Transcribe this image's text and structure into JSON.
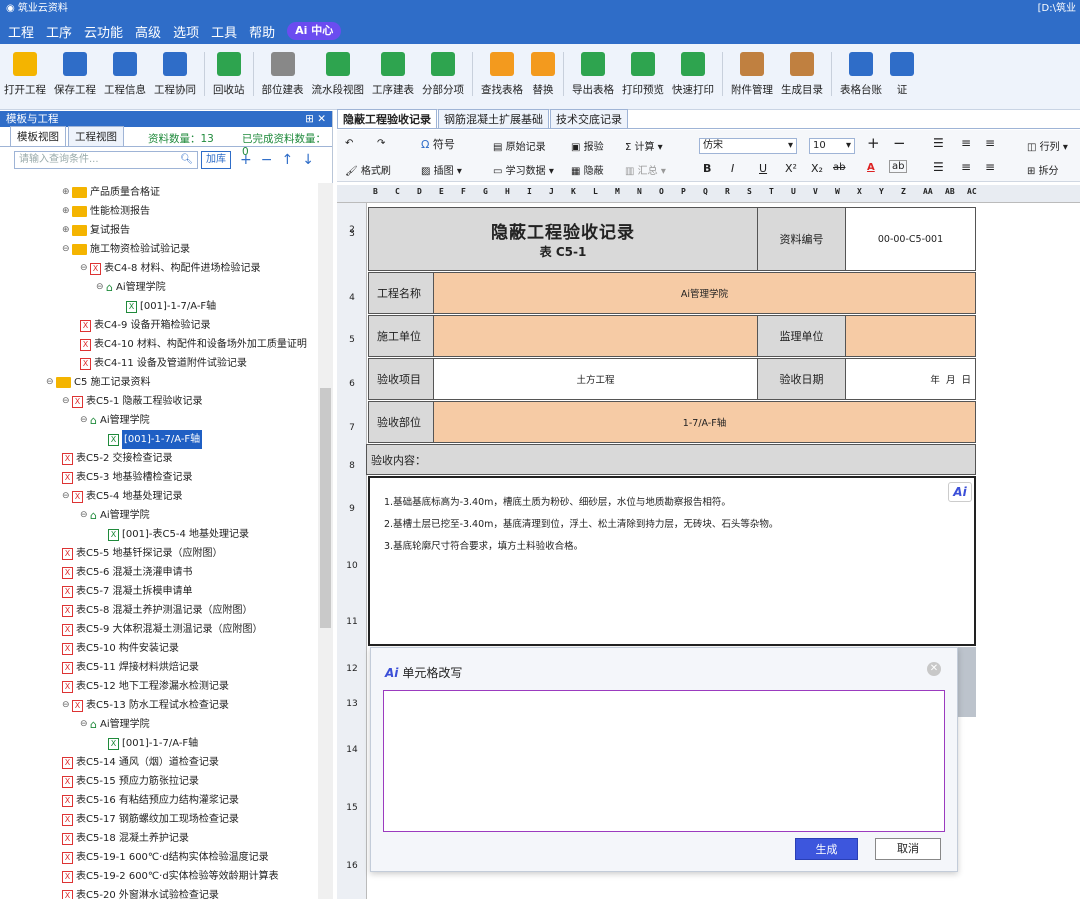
{
  "app": {
    "title": "筑业云资料",
    "path": "[D:\\筑业"
  },
  "menu": [
    "工程",
    "工序",
    "云功能",
    "高级",
    "选项",
    "工具",
    "帮助"
  ],
  "menu_ai": "Ai 中心",
  "toolbar": [
    {
      "label": "打开工程",
      "icon": "open-folder-icon",
      "color": "#f4b400"
    },
    {
      "label": "保存工程",
      "icon": "save-icon",
      "color": "#2f6dc8"
    },
    {
      "label": "工程信息",
      "icon": "project-info-icon",
      "color": "#2f6dc8"
    },
    {
      "label": "工程协同",
      "icon": "handshake-icon",
      "color": "#2f6dc8"
    },
    {
      "label": "回收站",
      "icon": "trash-icon",
      "color": "#2ea44f"
    },
    {
      "label": "部位建表",
      "icon": "table-part-icon",
      "color": "#888888"
    },
    {
      "label": "流水段视图",
      "icon": "flow-view-icon",
      "color": "#2ea44f"
    },
    {
      "label": "工序建表",
      "icon": "process-table-icon",
      "color": "#2ea44f"
    },
    {
      "label": "分部分项",
      "icon": "bar-chart-icon",
      "color": "#2ea44f"
    },
    {
      "label": "查找表格",
      "icon": "find-table-icon",
      "color": "#f39a1e"
    },
    {
      "label": "替换",
      "icon": "replace-icon",
      "color": "#f39a1e"
    },
    {
      "label": "导出表格",
      "icon": "export-icon",
      "color": "#2ea44f"
    },
    {
      "label": "打印预览",
      "icon": "print-preview-icon",
      "color": "#2ea44f"
    },
    {
      "label": "快速打印",
      "icon": "printer-icon",
      "color": "#2ea44f"
    },
    {
      "label": "附件管理",
      "icon": "attachment-icon",
      "color": "#c08040"
    },
    {
      "label": "生成目录",
      "icon": "catalog-icon",
      "color": "#c08040"
    },
    {
      "label": "表格台账",
      "icon": "ledger-icon",
      "color": "#2f6dc8"
    },
    {
      "label": "证",
      "icon": "cert-icon",
      "color": "#2f6dc8"
    }
  ],
  "left_panel": {
    "title": "模板与工程",
    "tab_template": "模板视图",
    "tab_project": "工程视图",
    "count_label": "资料数量：13",
    "done_label": "已完成资料数量：0",
    "search_placeholder": "请输入查询条件...",
    "search_add_btn": "加库"
  },
  "tree": [
    {
      "text": "产品质量合格证",
      "icon": "folder",
      "indent": 62,
      "toggle": "⊕"
    },
    {
      "text": "性能检测报告",
      "icon": "folder",
      "indent": 62,
      "toggle": "⊕"
    },
    {
      "text": "复试报告",
      "icon": "folder",
      "indent": 62,
      "toggle": "⊕"
    },
    {
      "text": "施工物资检验试验记录",
      "icon": "folder",
      "indent": 62,
      "toggle": "⊖"
    },
    {
      "text": "表C4-8 材料、构配件进场检验记录",
      "icon": "xr",
      "indent": 80,
      "toggle": "⊖"
    },
    {
      "text": "Ai管理学院",
      "icon": "home",
      "indent": 96,
      "toggle": "⊖"
    },
    {
      "text": "[001]-1-7/A-F轴",
      "icon": "xg",
      "indent": 126,
      "toggle": ""
    },
    {
      "text": "表C4-9 设备开箱检验记录",
      "icon": "xr",
      "indent": 80,
      "toggle": ""
    },
    {
      "text": "表C4-10 材料、构配件和设备场外加工质量证明",
      "icon": "xr",
      "indent": 80,
      "toggle": ""
    },
    {
      "text": "表C4-11 设备及管道附件试验记录",
      "icon": "xr",
      "indent": 80,
      "toggle": ""
    },
    {
      "text": "C5 施工记录资料",
      "icon": "folder",
      "indent": 46,
      "toggle": "⊖"
    },
    {
      "text": "表C5-1 隐蔽工程验收记录",
      "icon": "xr",
      "indent": 62,
      "toggle": "⊖"
    },
    {
      "text": "Ai管理学院",
      "icon": "home",
      "indent": 80,
      "toggle": "⊖"
    },
    {
      "text": "[001]-1-7/A-F轴",
      "icon": "xg",
      "indent": 108,
      "toggle": "",
      "selected": true
    },
    {
      "text": "表C5-2 交接检查记录",
      "icon": "xr",
      "indent": 62,
      "toggle": ""
    },
    {
      "text": "表C5-3 地基验槽检查记录",
      "icon": "xr",
      "indent": 62,
      "toggle": ""
    },
    {
      "text": "表C5-4 地基处理记录",
      "icon": "xr",
      "indent": 62,
      "toggle": "⊖"
    },
    {
      "text": "Ai管理学院",
      "icon": "home",
      "indent": 80,
      "toggle": "⊖"
    },
    {
      "text": "[001]-表C5-4 地基处理记录",
      "icon": "xg",
      "indent": 108,
      "toggle": ""
    },
    {
      "text": "表C5-5 地基钎探记录（应附图）",
      "icon": "xr",
      "indent": 62,
      "toggle": ""
    },
    {
      "text": "表C5-6 混凝土浇灌申请书",
      "icon": "xr",
      "indent": 62,
      "toggle": ""
    },
    {
      "text": "表C5-7 混凝土拆模申请单",
      "icon": "xr",
      "indent": 62,
      "toggle": ""
    },
    {
      "text": "表C5-8 混凝土养护测温记录（应附图）",
      "icon": "xr",
      "indent": 62,
      "toggle": ""
    },
    {
      "text": "表C5-9 大体积混凝土测温记录（应附图）",
      "icon": "xr",
      "indent": 62,
      "toggle": ""
    },
    {
      "text": "表C5-10 构件安装记录",
      "icon": "xr",
      "indent": 62,
      "toggle": ""
    },
    {
      "text": "表C5-11 焊接材料烘焙记录",
      "icon": "xr",
      "indent": 62,
      "toggle": ""
    },
    {
      "text": "表C5-12 地下工程渗漏水检测记录",
      "icon": "xr",
      "indent": 62,
      "toggle": ""
    },
    {
      "text": "表C5-13 防水工程试水检查记录",
      "icon": "xr",
      "indent": 62,
      "toggle": "⊖"
    },
    {
      "text": "Ai管理学院",
      "icon": "home",
      "indent": 80,
      "toggle": "⊖"
    },
    {
      "text": "[001]-1-7/A-F轴",
      "icon": "xg",
      "indent": 108,
      "toggle": ""
    },
    {
      "text": "表C5-14 通风（烟）道检查记录",
      "icon": "xr",
      "indent": 62,
      "toggle": ""
    },
    {
      "text": "表C5-15 预应力筋张拉记录",
      "icon": "xr",
      "indent": 62,
      "toggle": ""
    },
    {
      "text": "表C5-16 有粘结预应力结构灌浆记录",
      "icon": "xr",
      "indent": 62,
      "toggle": ""
    },
    {
      "text": "表C5-17 钢筋螺纹加工现场检查记录",
      "icon": "xr",
      "indent": 62,
      "toggle": ""
    },
    {
      "text": "表C5-18 混凝土养护记录",
      "icon": "xr",
      "indent": 62,
      "toggle": ""
    },
    {
      "text": "表C5-19-1 600℃·d结构实体检验温度记录",
      "icon": "xr",
      "indent": 62,
      "toggle": ""
    },
    {
      "text": "表C5-19-2 600℃·d实体检验等效龄期计算表",
      "icon": "xr",
      "indent": 62,
      "toggle": ""
    },
    {
      "text": "表C5-20 外窗淋水试验检查记录",
      "icon": "xr",
      "indent": 62,
      "toggle": ""
    }
  ],
  "doc_tabs": [
    "隐蔽工程验收记录",
    "钢筋混凝土扩展基础",
    "技术交底记录"
  ],
  "ribbon": {
    "symbol": "符号",
    "original": "原始记录",
    "report": "报验",
    "calc": "Σ 计算",
    "format_brush": "格式刷",
    "insert_img": "插图",
    "learn": "学习数据",
    "hide": "隐蔽",
    "summary": "汇总",
    "font": "仿宋",
    "size": "10",
    "row_col": "行列",
    "split": "拆分",
    "bold": "B",
    "italic": "I",
    "underline": "U",
    "sup": "X²",
    "sub": "X₂",
    "strike": "ab",
    "color": "A",
    "pinyin": "ab"
  },
  "columns": [
    "B",
    "C",
    "D",
    "E",
    "F",
    "G",
    "H",
    "I",
    "J",
    "K",
    "L",
    "M",
    "N",
    "O",
    "P",
    "Q",
    "R",
    "S",
    "T",
    "U",
    "V",
    "W",
    "X",
    "Y",
    "Z",
    "AA",
    "AB",
    "AC"
  ],
  "rows": [
    "2",
    "3",
    "4",
    "5",
    "6",
    "7",
    "8",
    "9",
    "10",
    "11",
    "12",
    "13",
    "14",
    "15",
    "16"
  ],
  "form": {
    "title": "隐蔽工程验收记录",
    "subtitle": "表 C5-1",
    "doc_no_label": "资料编号",
    "doc_no": "00-00-C5-001",
    "project_label": "工程名称",
    "project": "Ai管理学院",
    "builder_label": "施工单位",
    "builder": "",
    "supervisor_label": "监理单位",
    "supervisor": "",
    "item_label": "验收项目",
    "item": "土方工程",
    "date_label": "验收日期",
    "date": "年  月  日",
    "part_label": "验收部位",
    "part": "1-7/A-F轴",
    "content_label": "验收内容：",
    "content": [
      "1.基础基底标高为-3.40m，槽底土质为粉砂、细砂层，水位与地质勘察报告相符。",
      "2.基槽土层已挖至-3.40m，基底清理到位，浮土、松土清除到持力层，无砖块、石头等杂物。",
      "3.基底轮廓尺寸符合要求，填方土料验收合格。"
    ],
    "ai_badge": "Ai"
  },
  "dialog": {
    "title": "单元格改写",
    "title_prefix": "Ai",
    "generate": "生成",
    "cancel": "取消",
    "accent": "#3d56dd"
  }
}
